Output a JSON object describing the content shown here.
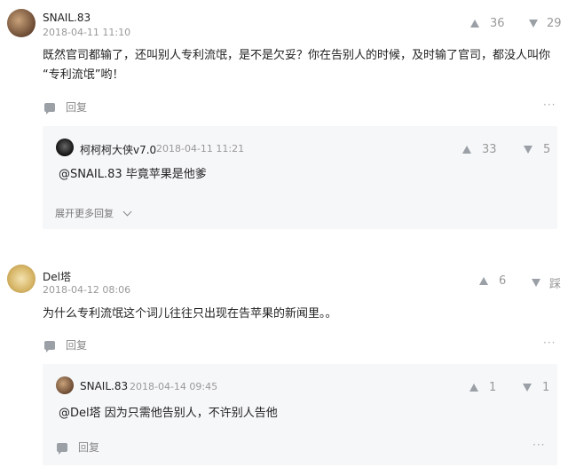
{
  "comments": [
    {
      "user": "SNAIL.83",
      "time": "2018-04-11 11:10",
      "up": "36",
      "down": "29",
      "text_line1": "既然官司都输了，还叫别人专利流氓，是不是欠妥？你在告别人的时候，及时输了官司，都没人叫你",
      "text_line2": "“专利流氓”哟！",
      "reply_label": "回复",
      "more": "···",
      "reply": {
        "user": "柯柯柯大侠v7.0",
        "time": "2018-04-11 11:21",
        "up": "33",
        "down": "5",
        "text": "@SNAIL.83  毕竟苹果是他爹",
        "expand": "展开更多回复"
      }
    },
    {
      "user": "Del塔",
      "time": "2018-04-12 08:06",
      "up": "6",
      "down": "踩",
      "text": "为什么专利流氓这个词儿往往只出现在告苹果的新闻里。。",
      "reply_label": "回复",
      "more": "···",
      "reply": {
        "user": "SNAIL.83",
        "time": "2018-04-14 09:45",
        "up": "1",
        "down": "1",
        "text": "@Del塔  因为只需他告别人，不许别人告他",
        "reply_label": "回复",
        "more": "···"
      }
    }
  ],
  "colors": {
    "panel": "#f6f7f9",
    "icon": "#9aa0a6"
  }
}
